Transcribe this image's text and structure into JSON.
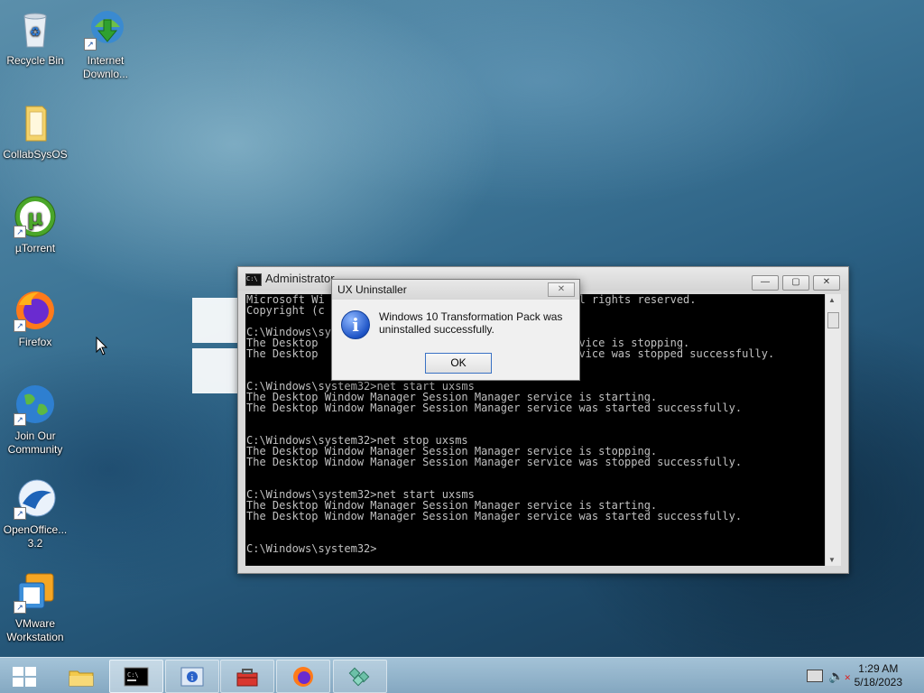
{
  "desktop": {
    "icons": [
      {
        "label": "Recycle Bin",
        "icon": "recycle-bin-icon"
      },
      {
        "label": "Internet Downlo...",
        "icon": "internet-download-manager-icon"
      },
      {
        "label": "CollabSysOS",
        "icon": "folder-icon"
      },
      {
        "label": "µTorrent",
        "icon": "utorrent-icon"
      },
      {
        "label": "Firefox",
        "icon": "firefox-icon"
      },
      {
        "label": "Join Our Community",
        "icon": "globe-icon"
      },
      {
        "label": "OpenOffice... 3.2",
        "icon": "openoffice-icon"
      },
      {
        "label": "VMware Workstation",
        "icon": "vmware-icon"
      }
    ]
  },
  "console": {
    "title": "Administrator",
    "lines": "Microsoft Wi                                       l rights reserved.\nCopyright (c                                       \n\nC:\\Windows\\sy\nThe Desktop                                        vice is stopping.\nThe Desktop                                        vice was stopped successfully.\n\n\nC:\\Windows\\system32>net start uxsms\nThe Desktop Window Manager Session Manager service is starting.\nThe Desktop Window Manager Session Manager service was started successfully.\n\n\nC:\\Windows\\system32>net stop uxsms\nThe Desktop Window Manager Session Manager service is stopping.\nThe Desktop Window Manager Session Manager service was stopped successfully.\n\n\nC:\\Windows\\system32>net start uxsms\nThe Desktop Window Manager Session Manager service is starting.\nThe Desktop Window Manager Session Manager service was started successfully.\n\n\nC:\\Windows\\system32>"
  },
  "dialog": {
    "title": "UX Uninstaller",
    "message": "Windows 10 Transformation Pack was uninstalled successfully.",
    "ok_label": "OK",
    "icon": "info-icon"
  },
  "taskbar": {
    "items": [
      {
        "name": "file-explorer",
        "icon": "folder-icon"
      },
      {
        "name": "command-prompt",
        "icon": "cmd-icon",
        "active": true
      },
      {
        "name": "system-info",
        "icon": "info-window-icon"
      },
      {
        "name": "toolbox",
        "icon": "toolbox-icon"
      },
      {
        "name": "firefox",
        "icon": "firefox-icon"
      },
      {
        "name": "installer",
        "icon": "installer-icon"
      }
    ],
    "time": "1:29 AM",
    "date": "5/18/2023"
  },
  "colors": {
    "accent": "#3a72c4",
    "console_bg": "#000000",
    "console_text": "#c0c0c0"
  }
}
